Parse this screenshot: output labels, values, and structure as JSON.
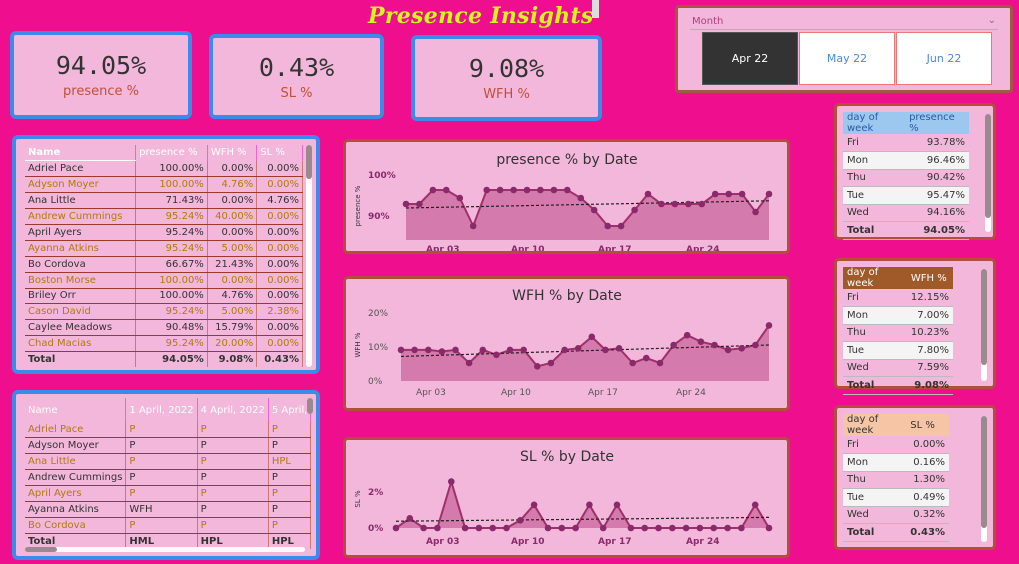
{
  "title": "Presence Insights",
  "slicer": {
    "header": "Month",
    "options": [
      "Apr 22",
      "May 22",
      "Jun 22"
    ],
    "selected": "Apr 22"
  },
  "kpis": [
    {
      "value": "94.05%",
      "label": "presence %"
    },
    {
      "value": "0.43%",
      "label": "SL %"
    },
    {
      "value": "9.08%",
      "label": "WFH %"
    }
  ],
  "employee_table": {
    "headers": [
      "Name",
      "presence %",
      "WFH %",
      "SL %"
    ],
    "rows": [
      [
        "Adriel Pace",
        "100.00%",
        "0.00%",
        "0.00%"
      ],
      [
        "Adyson Moyer",
        "100.00%",
        "4.76%",
        "0.00%"
      ],
      [
        "Ana Little",
        "71.43%",
        "0.00%",
        "4.76%"
      ],
      [
        "Andrew Cummings",
        "95.24%",
        "40.00%",
        "0.00%"
      ],
      [
        "April Ayers",
        "95.24%",
        "0.00%",
        "0.00%"
      ],
      [
        "Ayanna Atkins",
        "95.24%",
        "5.00%",
        "0.00%"
      ],
      [
        "Bo Cordova",
        "66.67%",
        "21.43%",
        "0.00%"
      ],
      [
        "Boston Morse",
        "100.00%",
        "0.00%",
        "0.00%"
      ],
      [
        "Briley Orr",
        "100.00%",
        "4.76%",
        "0.00%"
      ],
      [
        "Cason David",
        "95.24%",
        "5.00%",
        "2.38%"
      ],
      [
        "Caylee Meadows",
        "90.48%",
        "15.79%",
        "0.00%"
      ],
      [
        "Chad Macias",
        "95.24%",
        "20.00%",
        "0.00%"
      ]
    ],
    "total": [
      "Total",
      "94.05%",
      "9.08%",
      "0.43%"
    ]
  },
  "daily_table": {
    "headers": [
      "Name",
      "1 April, 2022",
      "4 April, 2022",
      "5 April,"
    ],
    "rows": [
      [
        "Adriel Pace",
        "P",
        "P",
        "P"
      ],
      [
        "Adyson Moyer",
        "P",
        "P",
        "P"
      ],
      [
        "Ana Little",
        "P",
        "P",
        "HPL"
      ],
      [
        "Andrew Cummings",
        "P",
        "P",
        "P"
      ],
      [
        "April Ayers",
        "P",
        "P",
        "P"
      ],
      [
        "Ayanna Atkins",
        "WFH",
        "P",
        "P"
      ],
      [
        "Bo Cordova",
        "P",
        "P",
        "P"
      ]
    ],
    "total": [
      "Total",
      "HML",
      "HPL",
      "HPL"
    ]
  },
  "chart_data": [
    {
      "type": "area",
      "title": "presence % by Date",
      "ylabel": "presence %",
      "y_ticks": [
        "100%",
        "90%"
      ],
      "x_ticks": [
        "Apr 03",
        "Apr 10",
        "Apr 17",
        "Apr 24"
      ],
      "ylim": [
        85,
        102
      ],
      "x": [
        1,
        2,
        3,
        4,
        5,
        6,
        7,
        8,
        9,
        10,
        11,
        12,
        13,
        14,
        15,
        16,
        17,
        18,
        19,
        20,
        21,
        22,
        23,
        24,
        25,
        26,
        27,
        28
      ],
      "values": [
        94,
        94,
        97.5,
        97.5,
        95.5,
        88.5,
        97.5,
        97.5,
        97.5,
        97.5,
        97.5,
        97.5,
        97.5,
        95.5,
        92.5,
        88.5,
        88.5,
        92.5,
        96.5,
        94,
        94,
        94,
        94,
        96.5,
        96.5,
        96.5,
        92,
        96.5
      ],
      "trend": [
        93.0,
        94.8
      ]
    },
    {
      "type": "area",
      "title": "WFH % by Date",
      "ylabel": "WFH %",
      "y_ticks": [
        "20%",
        "10%",
        "0%"
      ],
      "x_ticks": [
        "Apr 03",
        "Apr 10",
        "Apr 17",
        "Apr 24"
      ],
      "ylim": [
        0,
        22
      ],
      "x": [
        1,
        2,
        3,
        4,
        5,
        6,
        7,
        8,
        9,
        10,
        11,
        12,
        13,
        14,
        15,
        16,
        17,
        18,
        19,
        20,
        21,
        22,
        23,
        24,
        25,
        26,
        27,
        28
      ],
      "values": [
        9.5,
        9.5,
        9.5,
        9.0,
        9.5,
        5.5,
        9.5,
        8.0,
        9.5,
        9.5,
        4.5,
        5.5,
        9.5,
        10.0,
        13.5,
        9.5,
        10.0,
        5.5,
        7.0,
        5.5,
        11.0,
        14.0,
        12.0,
        11.0,
        9.5,
        10.0,
        11.0,
        17.0
      ],
      "trend": [
        7.5,
        11.0
      ]
    },
    {
      "type": "area",
      "title": "SL % by Date",
      "ylabel": "SL %",
      "y_ticks": [
        "2%",
        "0%"
      ],
      "x_ticks": [
        "Apr 03",
        "Apr 10",
        "Apr 17",
        "Apr 24"
      ],
      "ylim": [
        0,
        3
      ],
      "x": [
        1,
        2,
        3,
        4,
        5,
        6,
        7,
        8,
        9,
        10,
        11,
        12,
        13,
        14,
        15,
        16,
        17,
        18,
        19,
        20,
        21,
        22,
        23,
        24,
        25,
        26,
        27,
        28
      ],
      "values": [
        0,
        0.5,
        0,
        0,
        2.4,
        0,
        0,
        0,
        0,
        0.4,
        1.2,
        0,
        0,
        0,
        1.2,
        0,
        1.2,
        0,
        0,
        0,
        0,
        0,
        0,
        0,
        0,
        0,
        1.2,
        0
      ],
      "trend": [
        0.35,
        0.55
      ]
    }
  ],
  "dow_presence": {
    "headers": [
      "day of week",
      "presence %"
    ],
    "rows": [
      [
        "Fri",
        "93.78%"
      ],
      [
        "Mon",
        "96.46%"
      ],
      [
        "Thu",
        "90.42%"
      ],
      [
        "Tue",
        "95.47%"
      ],
      [
        "Wed",
        "94.16%"
      ]
    ],
    "total": [
      "Total",
      "94.05%"
    ]
  },
  "dow_wfh": {
    "headers": [
      "day of week",
      "WFH %"
    ],
    "rows": [
      [
        "Fri",
        "12.15%"
      ],
      [
        "Mon",
        "7.00%"
      ],
      [
        "Thu",
        "10.23%"
      ],
      [
        "Tue",
        "7.80%"
      ],
      [
        "Wed",
        "7.59%"
      ]
    ],
    "total": [
      "Total",
      "9.08%"
    ]
  },
  "dow_sl": {
    "headers": [
      "day of week",
      "SL %"
    ],
    "rows": [
      [
        "Fri",
        "0.00%"
      ],
      [
        "Mon",
        "0.16%"
      ],
      [
        "Thu",
        "1.30%"
      ],
      [
        "Tue",
        "0.49%"
      ],
      [
        "Wed",
        "0.32%"
      ]
    ],
    "total": [
      "Total",
      "0.43%"
    ]
  },
  "colors": {
    "background": "#EE0E8E",
    "panel": "#F2B7DB",
    "line": "#A0306A",
    "area": "#C9609A",
    "title": "#D4F51E"
  }
}
